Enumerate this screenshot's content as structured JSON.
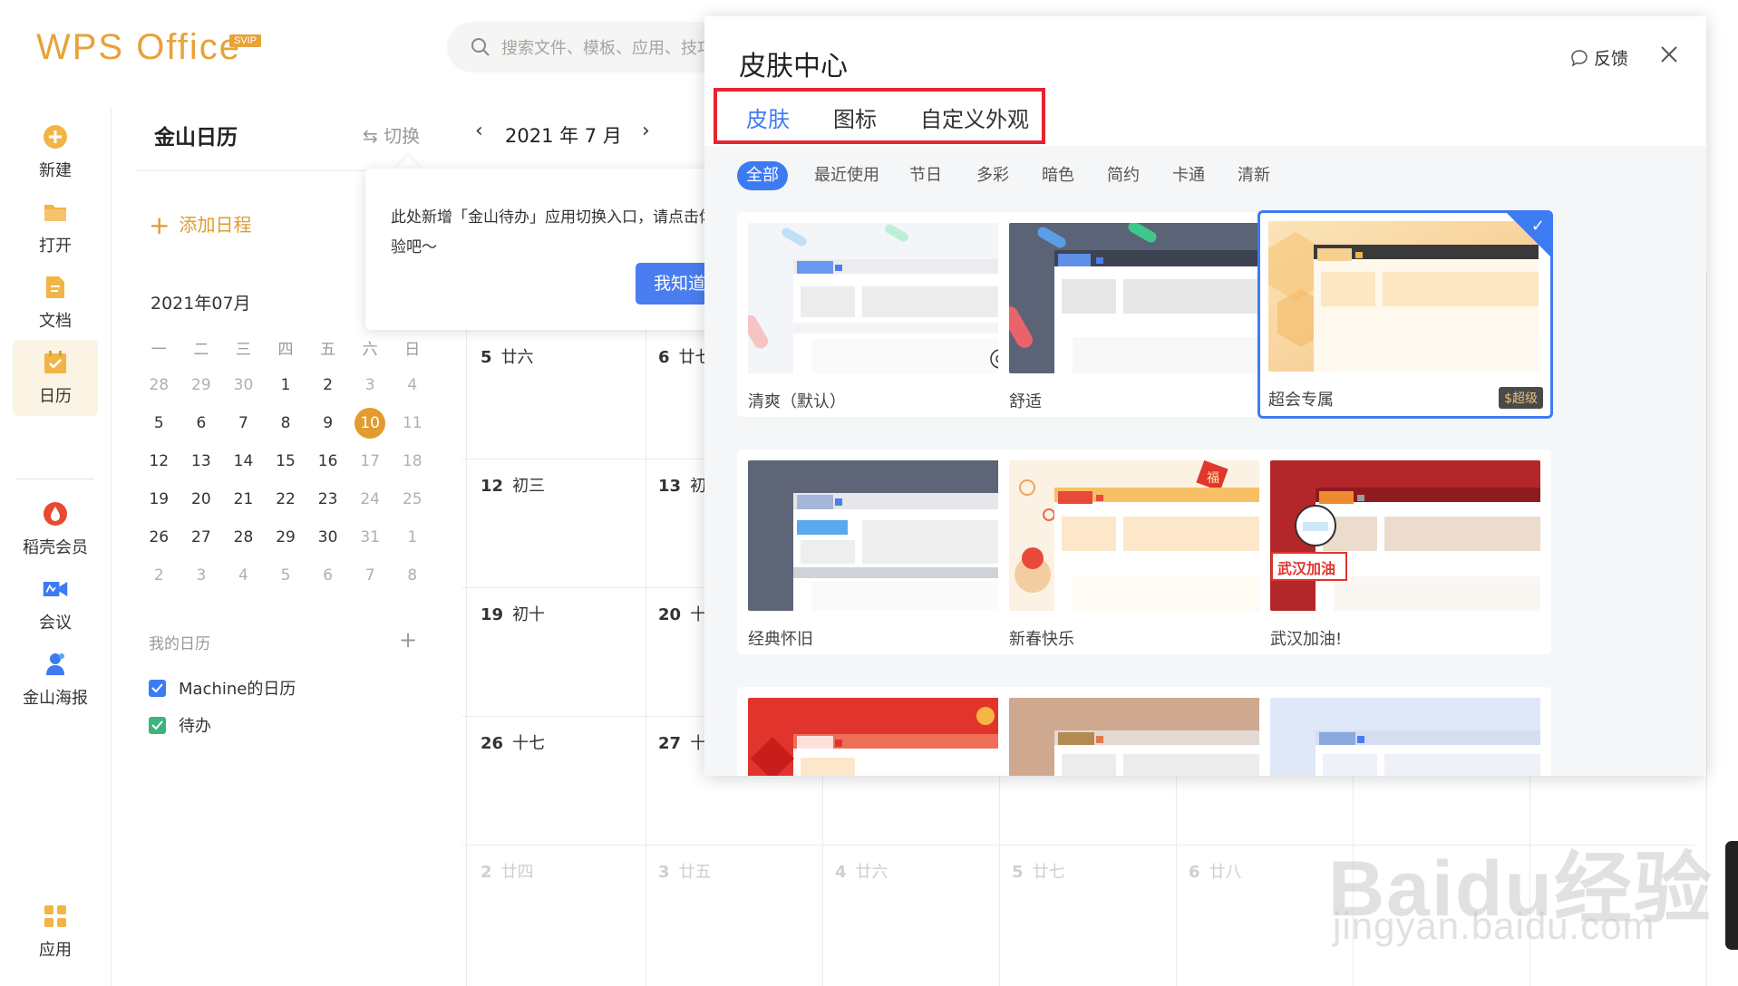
{
  "header": {
    "logo": "WPS Office",
    "badge": "SVIP",
    "search_placeholder": "搜索文件、模板、应用、技巧"
  },
  "rail": {
    "items": [
      {
        "label": "新建",
        "icon": "plus-circle-icon"
      },
      {
        "label": "打开",
        "icon": "folder-icon"
      },
      {
        "label": "文档",
        "icon": "document-icon"
      },
      {
        "label": "日历",
        "icon": "calendar-icon"
      },
      {
        "label": "稻壳会员",
        "icon": "docer-icon"
      },
      {
        "label": "会议",
        "icon": "meeting-icon"
      },
      {
        "label": "金山海报",
        "icon": "poster-icon"
      },
      {
        "label": "应用",
        "icon": "apps-grid-icon"
      }
    ]
  },
  "calendar_sidebar": {
    "title": "金山日历",
    "switch_label": "⇆ 切换",
    "add_schedule": "添加日程",
    "mini_month": "2021年07月",
    "weekdays": [
      "一",
      "二",
      "三",
      "四",
      "五",
      "六",
      "日"
    ],
    "weeks": [
      [
        "28",
        "29",
        "30",
        "1",
        "2",
        "3",
        "4"
      ],
      [
        "5",
        "6",
        "7",
        "8",
        "9",
        "10",
        "11"
      ],
      [
        "12",
        "13",
        "14",
        "15",
        "16",
        "17",
        "18"
      ],
      [
        "19",
        "20",
        "21",
        "22",
        "23",
        "24",
        "25"
      ],
      [
        "26",
        "27",
        "28",
        "29",
        "30",
        "31",
        "1"
      ],
      [
        "2",
        "3",
        "4",
        "5",
        "6",
        "7",
        "8"
      ]
    ],
    "today": "10",
    "my_calendars_title": "我的日历",
    "calendars": [
      {
        "label": "Machine的日历",
        "color": "#3d7bf3"
      },
      {
        "label": "待办",
        "color": "#3cb57a"
      }
    ]
  },
  "main_calendar": {
    "month_label": "2021 年 7 月",
    "prev_icon": "‹",
    "next_icon": "›",
    "row_days": [
      [
        {
          "num": "5",
          "lunar": "廿六"
        },
        {
          "num": "6",
          "lunar": "廿七"
        }
      ],
      [
        {
          "num": "12",
          "lunar": "初三"
        },
        {
          "num": "13",
          "lunar": "初四"
        }
      ],
      [
        {
          "num": "19",
          "lunar": "初十"
        },
        {
          "num": "20",
          "lunar": "十一"
        }
      ],
      [
        {
          "num": "26",
          "lunar": "十七"
        },
        {
          "num": "27",
          "lunar": "十八"
        }
      ]
    ],
    "last_row": [
      {
        "num": "2",
        "lunar": "廿四"
      },
      {
        "num": "3",
        "lunar": "廿五"
      },
      {
        "num": "4",
        "lunar": "廿六"
      },
      {
        "num": "5",
        "lunar": "廿七"
      },
      {
        "num": "6",
        "lunar": "廿八"
      }
    ]
  },
  "tooltip": {
    "text": "此处新增「金山待办」应用切换入口，请点击体验吧～",
    "button": "我知道了"
  },
  "skin_center": {
    "title": "皮肤中心",
    "feedback": "反馈",
    "tabs": [
      "皮肤",
      "图标",
      "自定义外观"
    ],
    "active_tab": "皮肤",
    "filters": [
      "全部",
      "最近使用",
      "节日",
      "多彩",
      "暗色",
      "简约",
      "卡通",
      "清新"
    ],
    "active_filter": "全部",
    "skins": [
      {
        "label": "清爽（默认）"
      },
      {
        "label": "舒适"
      },
      {
        "label": "超会专属",
        "badge": "$超级",
        "selected": true
      },
      {
        "label": "经典怀旧"
      },
      {
        "label": "新春快乐"
      },
      {
        "label": "武汉加油!",
        "overlay_text": "武汉加油"
      },
      {
        "label": ""
      },
      {
        "label": ""
      },
      {
        "label": ""
      }
    ],
    "accent": "#3d7bf3",
    "highlight": "#e8232e"
  },
  "watermark": {
    "main": "Baidu经验",
    "sub": "jingyan.baidu.com"
  }
}
